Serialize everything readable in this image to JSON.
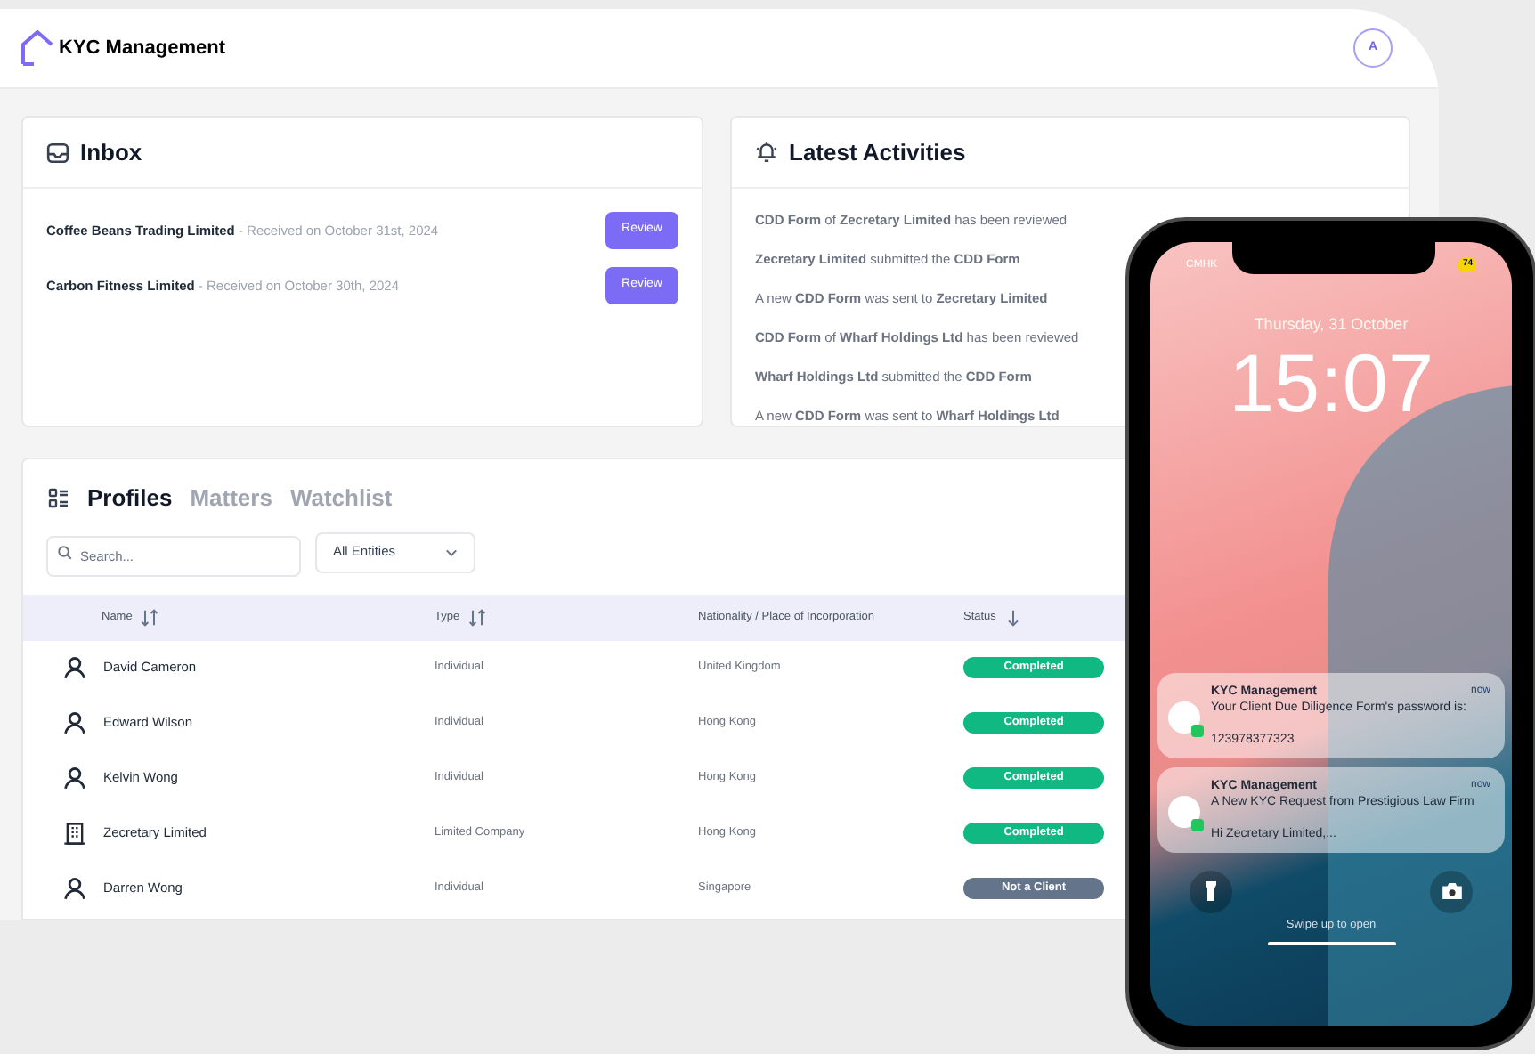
{
  "app": {
    "title": "KYC Management",
    "avatar": "A"
  },
  "inbox": {
    "title": "Inbox",
    "items": [
      {
        "name": "Coffee Beans Trading Limited",
        "received": " - Received on October 31st, 2024",
        "action": "Review"
      },
      {
        "name": "Carbon Fitness Limited",
        "received": " - Received on October 30th, 2024",
        "action": "Review"
      }
    ]
  },
  "activities": {
    "title": "Latest Activities",
    "items": [
      "**CDD Form** of **Zecretary Limited** has been reviewed",
      "**Zecretary Limited** submitted the **CDD Form**",
      "A new **CDD Form** was sent to **Zecretary Limited**",
      "**CDD Form** of **Wharf Holdings Ltd** has been reviewed",
      "**Wharf Holdings Ltd** submitted the **CDD Form**",
      "A new **CDD Form** was sent to **Wharf Holdings Ltd**"
    ]
  },
  "profiles": {
    "tabs": [
      {
        "label": "Profiles",
        "selected": true
      },
      {
        "label": "Matters",
        "selected": false
      },
      {
        "label": "Watchlist",
        "selected": false
      }
    ],
    "search": {
      "placeholder": "Search..."
    },
    "filter": {
      "value": "All Entities"
    },
    "columns": [
      {
        "label": "Name",
        "sortable": true,
        "sorted_descending": false
      },
      {
        "label": "Type",
        "sortable": true,
        "sorted_descending": false
      },
      {
        "label": "Nationality / Place of Incorporation",
        "sortable": false
      },
      {
        "label": "Status",
        "sortable": true,
        "sorted_descending": true
      }
    ],
    "rows": [
      {
        "kind": "person",
        "name": "David Cameron",
        "type": "Individual",
        "nationality": "United Kingdom",
        "status": "Completed",
        "color": "#10b981"
      },
      {
        "kind": "person",
        "name": "Edward Wilson",
        "type": "Individual",
        "nationality": "Hong Kong",
        "status": "Completed",
        "color": "#10b981"
      },
      {
        "kind": "person",
        "name": "Kelvin Wong",
        "type": "Individual",
        "nationality": "Hong Kong",
        "status": "Completed",
        "color": "#10b981"
      },
      {
        "kind": "company",
        "name": "Zecretary Limited",
        "type": "Limited Company",
        "nationality": "Hong Kong",
        "status": "Completed",
        "color": "#10b981"
      },
      {
        "kind": "person",
        "name": "Darren Wong",
        "type": "Individual",
        "nationality": "Singapore",
        "status": "Not a Client",
        "color": "#64748b"
      }
    ]
  },
  "phone": {
    "carrier": "CMHK",
    "battery": "74",
    "date": "Thursday, 31 October",
    "time": "15:07",
    "notifications": [
      {
        "app": "KYC Management",
        "time": "now",
        "title": "Your Client Due Diligence Form's password is:",
        "body": "123978377323"
      },
      {
        "app": "KYC Management",
        "time": "now",
        "title": "A New KYC Request from Prestigious Law Firm",
        "body": "Hi Zecretary Limited,..."
      }
    ],
    "hint": "Swipe up to open"
  }
}
